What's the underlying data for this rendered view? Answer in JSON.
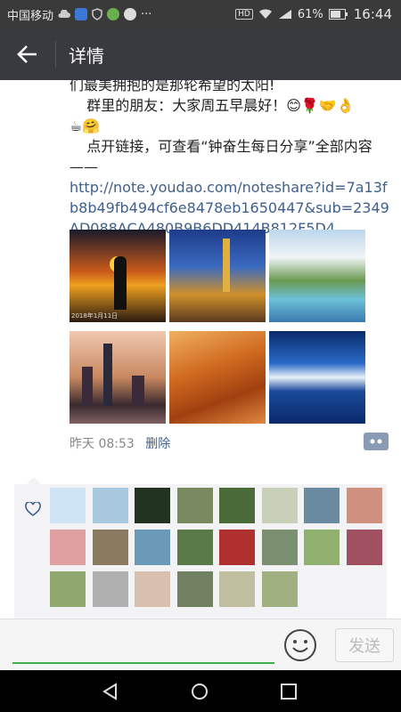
{
  "status_bar": {
    "carrier": "中国移动",
    "battery": "61%",
    "time": "16:44",
    "icons": [
      "cloud-icon",
      "note-app-icon",
      "shield-icon",
      "wechat-icon",
      "search-app-icon",
      "more-dots-icon",
      "hd-icon",
      "wifi-icon",
      "signal-icon",
      "battery-icon"
    ],
    "more": "···",
    "hd": "HD"
  },
  "header": {
    "title": "详情",
    "back_icon": "back-arrow-icon"
  },
  "post": {
    "line_cut": "们最美拥抱的是那轮希望的太阳!",
    "greeting": "群里的朋友：大家周五早晨好！😊🌹🤝👌",
    "greeting2": "☕🤗",
    "note": "点开链接，可查看“钟奋生每日分享”全部内容——",
    "link": "http://note.youdao.com/noteshare?id=7a13fb8b49fb494cf6e8478eb1650447&sub=2349AD088ACA480B9B6DD414B812F5D4",
    "photo_caption": "2018年1月11日",
    "photos": [
      "sunset-heron-photo",
      "city-night-photo",
      "fjord-photo",
      "skyline-photo",
      "desert-rock-photo",
      "snow-mountain-photo"
    ]
  },
  "meta": {
    "time": "昨天 08:53",
    "delete": "删除"
  },
  "likes": {
    "heart_icon": "heart-icon",
    "count_avatars": 22
  },
  "input": {
    "send": "发送",
    "emoji_icon": "emoji-icon"
  },
  "nav": {
    "icons": [
      "back-triangle-icon",
      "home-circle-icon",
      "recent-square-icon"
    ]
  },
  "colors": {
    "status_bg": "#3a3a3a",
    "header_bg": "#393a3f",
    "link": "#3f5f8c",
    "green": "#3eb04a"
  }
}
